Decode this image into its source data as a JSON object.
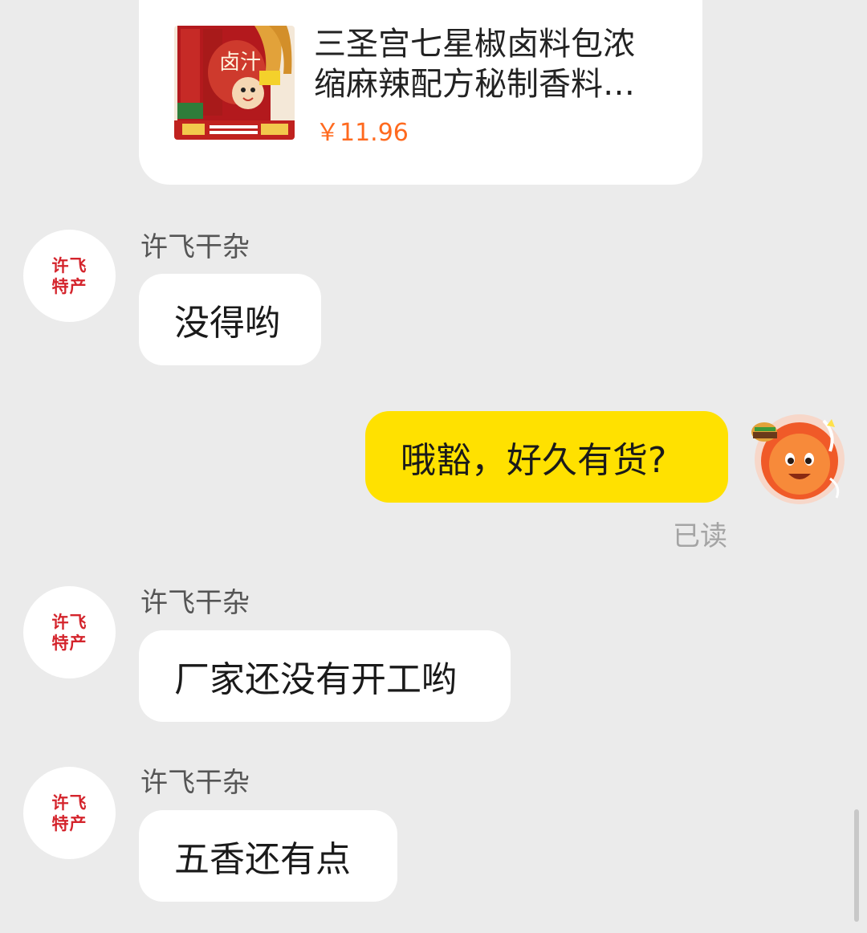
{
  "product_card": {
    "title": "三圣宫七星椒卤料包浓缩麻辣配方秘制香料…",
    "price": "￥11.96"
  },
  "messages": [
    {
      "sender": "许飞干杂",
      "avatar_text": "许飞特产",
      "text": "没得哟"
    },
    {
      "text": "哦豁，好久有货?",
      "status": "已读"
    },
    {
      "sender": "许飞干杂",
      "avatar_text": "许飞特产",
      "text": "厂家还没有开工哟"
    },
    {
      "sender": "许飞干杂",
      "avatar_text": "许飞特产",
      "text": "五香还有点"
    }
  ],
  "colors": {
    "background": "#ebebeb",
    "incoming_bubble": "#ffffff",
    "outgoing_bubble": "#ffe100",
    "price": "#ff6a1f",
    "avatar_text": "#d4242c"
  }
}
